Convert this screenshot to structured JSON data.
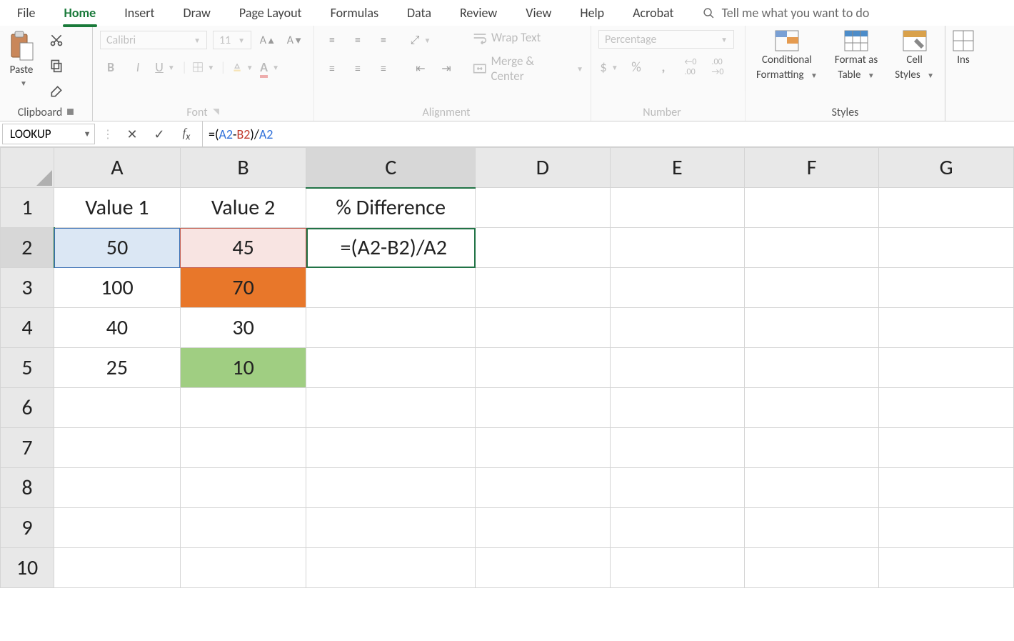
{
  "tabs": [
    "File",
    "Home",
    "Insert",
    "Draw",
    "Page Layout",
    "Formulas",
    "Data",
    "Review",
    "View",
    "Help",
    "Acrobat"
  ],
  "active_tab": "Home",
  "tellme_placeholder": "Tell me what you want to do",
  "ribbon": {
    "clipboard": {
      "label": "Clipboard",
      "paste": "Paste"
    },
    "font": {
      "label": "Font",
      "family": "Calibri",
      "size": "11"
    },
    "alignment": {
      "label": "Alignment",
      "wrap": "Wrap Text",
      "merge": "Merge & Center"
    },
    "number": {
      "label": "Number",
      "format": "Percentage"
    },
    "styles": {
      "label": "Styles",
      "conditional": "Conditional",
      "conditional2": "Formatting",
      "formatas": "Format as",
      "formatas2": "Table",
      "cellstyles": "Cell",
      "cellstyles2": "Styles"
    },
    "ins": "Ins"
  },
  "name_box": "LOOKUP",
  "formula_text": "=(A2-B2)/A2",
  "formula_parts": {
    "p1": "=(",
    "r1": "A2",
    "p2": "-",
    "r2": "B2",
    "p3": ")/",
    "r3": "A2"
  },
  "columns": [
    "A",
    "B",
    "C",
    "D",
    "E",
    "F",
    "G"
  ],
  "rows": [
    "1",
    "2",
    "3",
    "4",
    "5",
    "6",
    "7",
    "8",
    "9",
    "10"
  ],
  "sheet": {
    "headers": {
      "A1": "Value 1",
      "B1": "Value 2",
      "C1": "% Difference"
    },
    "data": {
      "A2": "50",
      "B2": "45",
      "C2": "=(A2-B2)/A2",
      "A3": "100",
      "B3": "70",
      "A4": "40",
      "B4": "30",
      "A5": "25",
      "B5": "10"
    }
  },
  "active_cell": "C2",
  "referenced_cells": {
    "blue": "A2",
    "red": "B2"
  },
  "highlighted_cells": {
    "orange": "B3",
    "green": "B5"
  }
}
